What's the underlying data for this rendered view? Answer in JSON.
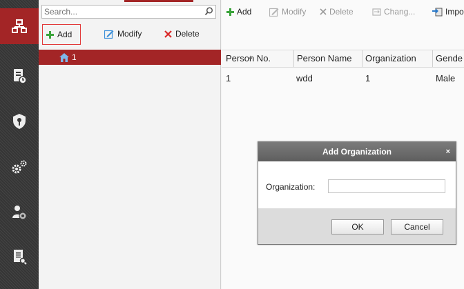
{
  "search": {
    "placeholder": "Search..."
  },
  "left_toolbar": {
    "add": "Add",
    "modify": "Modify",
    "delete": "Delete"
  },
  "tree": {
    "selected_label": "1"
  },
  "top_toolbar": {
    "add": "Add",
    "modify": "Modify",
    "delete": "Delete",
    "change": "Chang...",
    "import": "Impo"
  },
  "table": {
    "headers": [
      "Person No.",
      "Person Name",
      "Organization",
      "Gende"
    ],
    "rows": [
      [
        "1",
        "wdd",
        "1",
        "Male"
      ]
    ]
  },
  "modal": {
    "title": "Add Organization",
    "close": "×",
    "field_label": "Organization:",
    "field_value": "",
    "ok": "OK",
    "cancel": "Cancel"
  },
  "sidebar": {
    "icons": [
      "organization-icon",
      "device-icon",
      "access-control-icon",
      "settings-icon",
      "person-icon",
      "report-icon"
    ]
  },
  "colors": {
    "accent": "#a32526",
    "add_green": "#3aa33a",
    "delete_red": "#d92a2a",
    "modify_blue": "#3b8fd9"
  }
}
